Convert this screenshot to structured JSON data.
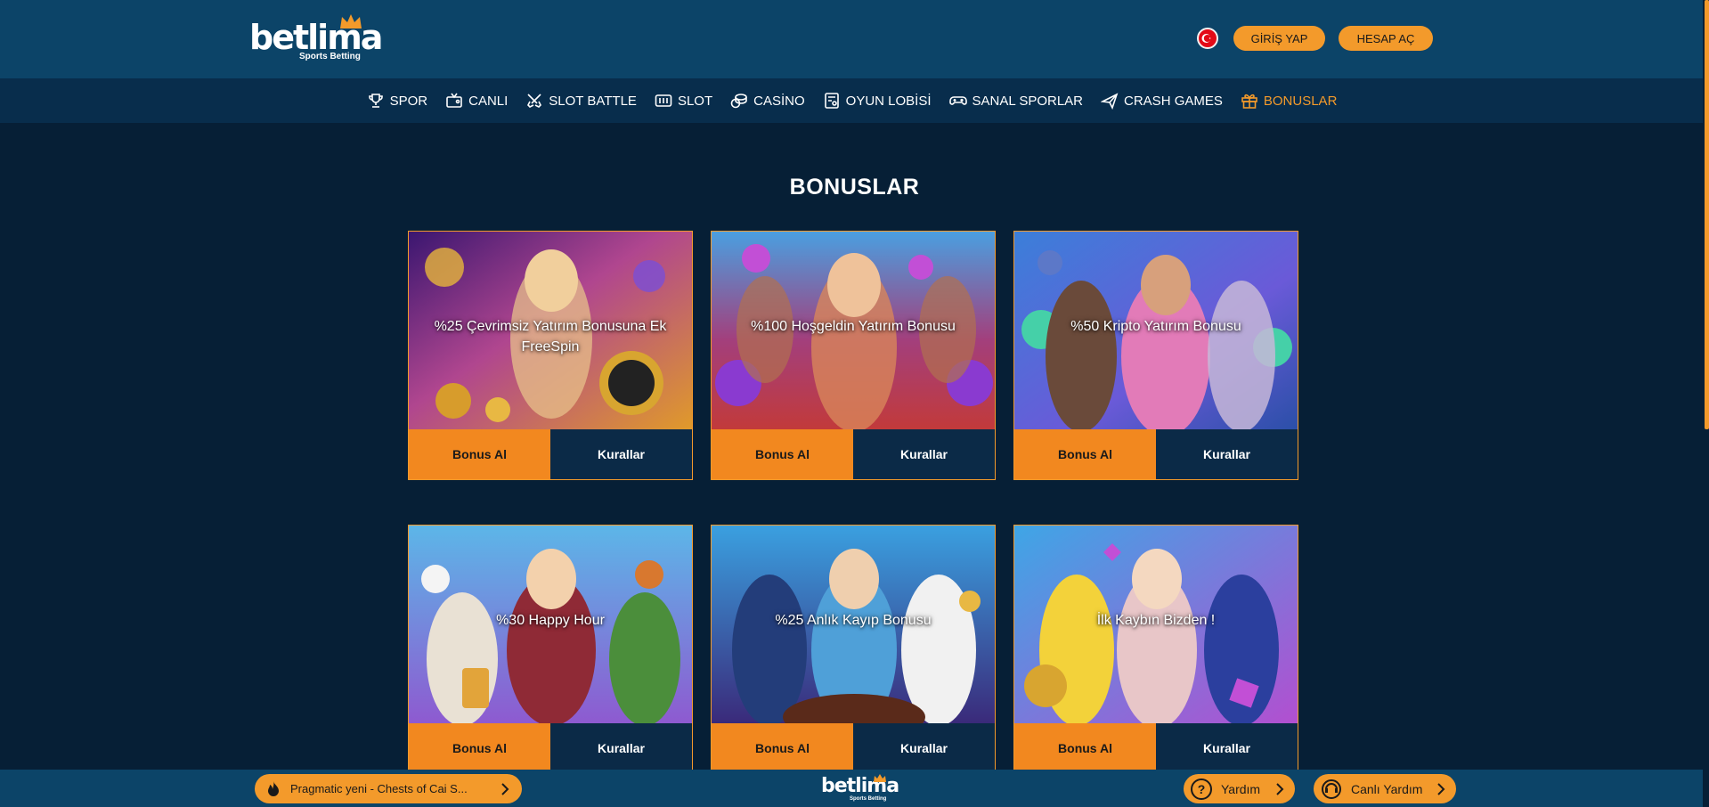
{
  "brand": {
    "name": "betlima",
    "tagline": "Sports Betting"
  },
  "header": {
    "login_label": "GİRİŞ YAP",
    "register_label": "HESAP AÇ"
  },
  "nav": {
    "items": [
      {
        "label": "SPOR",
        "icon": "trophy-icon"
      },
      {
        "label": "CANLI",
        "icon": "live-tv-icon"
      },
      {
        "label": "SLOT BATTLE",
        "icon": "crossed-swords-icon"
      },
      {
        "label": "SLOT",
        "icon": "slot-machine-icon"
      },
      {
        "label": "CASİNO",
        "icon": "casino-chips-icon"
      },
      {
        "label": "OYUN LOBİSİ",
        "icon": "game-lobby-icon"
      },
      {
        "label": "SANAL SPORLAR",
        "icon": "gamepad-icon"
      },
      {
        "label": "CRASH GAMES",
        "icon": "plane-icon"
      },
      {
        "label": "BONUSLAR",
        "icon": "gift-icon",
        "active": true
      }
    ]
  },
  "page": {
    "title": "BONUSLAR"
  },
  "cards": [
    {
      "title": "%25 Çevrimsiz Yatırım Bonusuna Ek FreeSpin",
      "bonus_label": "Bonus Al",
      "rules_label": "Kurallar"
    },
    {
      "title": "%100 Hoşgeldin Yatırım Bonusu",
      "bonus_label": "Bonus Al",
      "rules_label": "Kurallar"
    },
    {
      "title": "%50 Kripto Yatırım Bonusu",
      "bonus_label": "Bonus Al",
      "rules_label": "Kurallar"
    },
    {
      "title": "%30 Happy Hour",
      "bonus_label": "Bonus Al",
      "rules_label": "Kurallar"
    },
    {
      "title": "%25 Anlık Kayıp Bonusu",
      "bonus_label": "Bonus Al",
      "rules_label": "Kurallar"
    },
    {
      "title": "İlk Kaybın Bizden !",
      "bonus_label": "Bonus Al",
      "rules_label": "Kurallar"
    }
  ],
  "footer": {
    "ticker_text": "Pragmatic yeni - Chests of Cai S...",
    "help_label": "Yardım",
    "live_help_label": "Canlı Yardım"
  },
  "colors": {
    "accent": "#f39a2b",
    "header_bg": "#0c4468",
    "nav_bg": "#082d4c",
    "page_bg": "#061f36"
  }
}
